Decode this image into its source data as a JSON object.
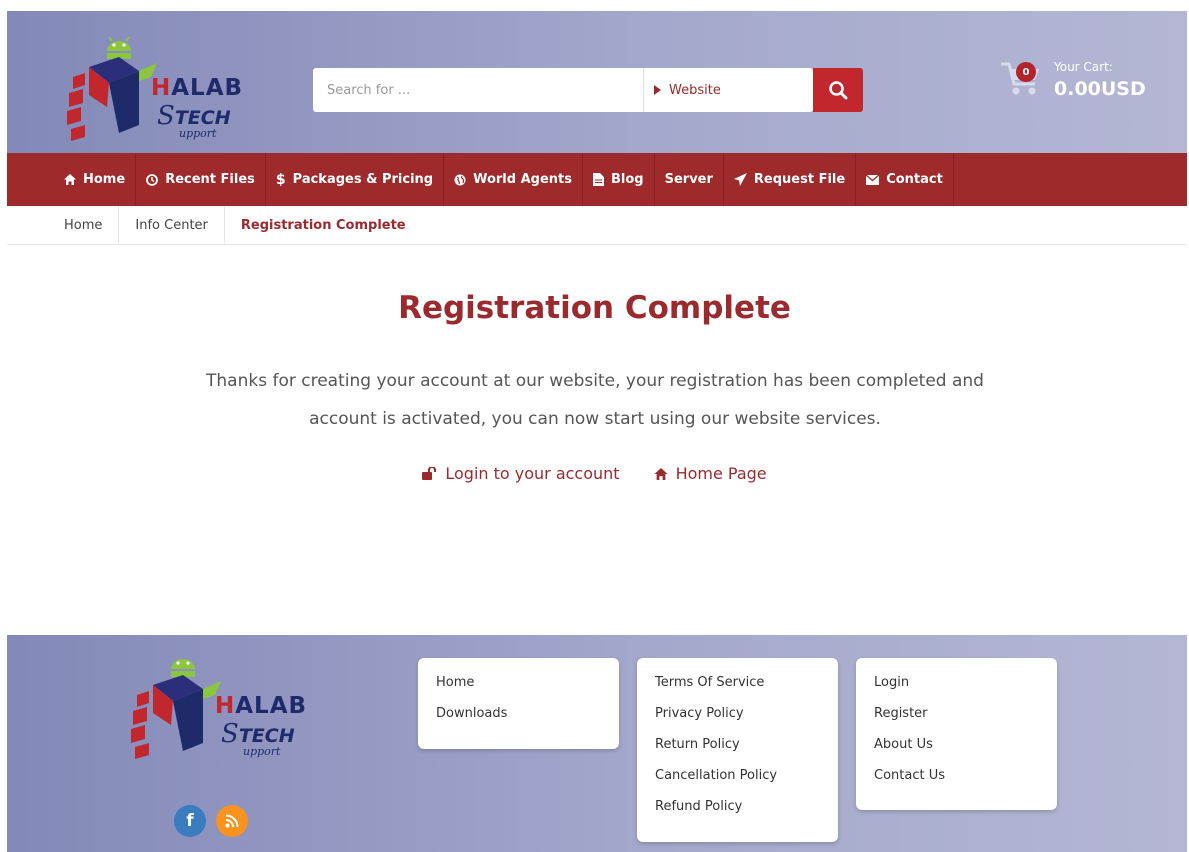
{
  "header": {
    "logo": {
      "word1": "HALAB",
      "word2": "TECH",
      "word3": "upport"
    },
    "search": {
      "placeholder": "Search for ...",
      "scope_label": "Website"
    },
    "cart": {
      "count": "0",
      "label": "Your Cart:",
      "total": "0.00USD"
    }
  },
  "nav": {
    "items": [
      {
        "label": "Home",
        "icon": "home-icon"
      },
      {
        "label": "Recent Files",
        "icon": "clock-icon"
      },
      {
        "label": "Packages & Pricing",
        "icon": "dollar-icon"
      },
      {
        "label": "World Agents",
        "icon": "globe-icon"
      },
      {
        "label": "Blog",
        "icon": "document-icon"
      },
      {
        "label": "Server",
        "icon": ""
      },
      {
        "label": "Request File",
        "icon": "send-icon"
      },
      {
        "label": "Contact",
        "icon": "envelope-icon"
      }
    ]
  },
  "breadcrumb": {
    "items": [
      "Home",
      "Info Center",
      "Registration Complete"
    ]
  },
  "main": {
    "title": "Registration Complete",
    "message_line1": "Thanks for creating your account at our website, your registration has been completed and",
    "message_line2": "account is activated, you can now start using our website services.",
    "login_link": "Login to your account",
    "home_link": "Home Page"
  },
  "footer": {
    "col1": [
      "Home",
      "Downloads"
    ],
    "col2": [
      "Terms Of Service",
      "Privacy Policy",
      "Return Policy",
      "Cancellation Policy",
      "Refund Policy"
    ],
    "col3": [
      "Login",
      "Register",
      "About Us",
      "Contact Us"
    ],
    "social": {
      "facebook": "f",
      "rss": "rss-icon"
    }
  },
  "colors": {
    "brand_red": "#9e2a2b",
    "accent_red": "#c1272d",
    "header_bg": "#a4a8cc",
    "logo_navy": "#1f2a6b"
  }
}
